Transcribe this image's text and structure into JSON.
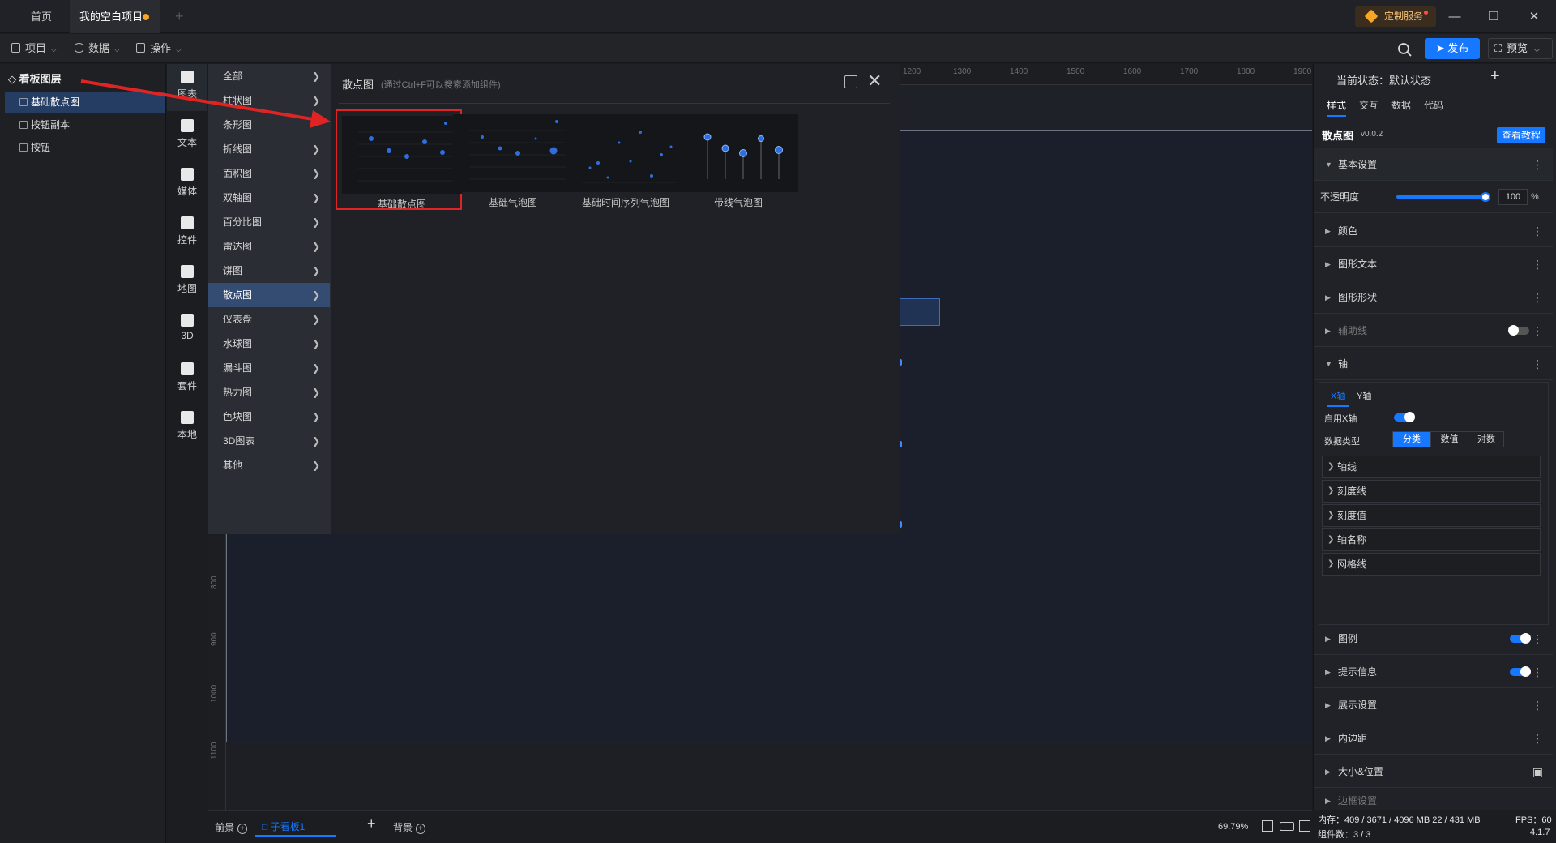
{
  "tabs": {
    "home": "首页",
    "project": "我的空白项目"
  },
  "custom_service": "定制服务",
  "menus": [
    {
      "label": "项目"
    },
    {
      "label": "数据"
    },
    {
      "label": "操作"
    }
  ],
  "toolbar": {
    "publish": "发布",
    "preview": "预览"
  },
  "layers": {
    "title": "看板图层",
    "items": [
      {
        "label": "基础散点图",
        "selected": true
      },
      {
        "label": "按钮副本",
        "selected": false
      },
      {
        "label": "按钮",
        "selected": false
      }
    ]
  },
  "categories": [
    {
      "label": "图表",
      "icon": "bar-chart-icon"
    },
    {
      "label": "文本",
      "icon": "text-icon"
    },
    {
      "label": "媒体",
      "icon": "media-icon"
    },
    {
      "label": "控件",
      "icon": "control-icon"
    },
    {
      "label": "地图",
      "icon": "map-icon"
    },
    {
      "label": "3D",
      "icon": "cube-icon"
    },
    {
      "label": "套件",
      "icon": "kit-icon"
    },
    {
      "label": "本地",
      "icon": "puzzle-icon"
    }
  ],
  "chart_types": [
    "全部",
    "柱状图",
    "条形图",
    "折线图",
    "面积图",
    "双轴图",
    "百分比图",
    "雷达图",
    "饼图",
    "散点图",
    "仪表盘",
    "水球图",
    "漏斗图",
    "热力图",
    "色块图",
    "3D图表",
    "其他"
  ],
  "chart_types_selected": "散点图",
  "picker": {
    "title": "散点图",
    "hint": "(通过Ctrl+F可以搜索添加组件)",
    "items": [
      {
        "label": "基础散点图",
        "selected": true
      },
      {
        "label": "基础气泡图",
        "selected": false
      },
      {
        "label": "基础时间序列气泡图",
        "selected": false
      },
      {
        "label": "带线气泡图",
        "selected": false
      }
    ]
  },
  "ruler": {
    "top": [
      "1200",
      "1300",
      "1400",
      "1500",
      "1600",
      "1700",
      "1800",
      "1900"
    ],
    "left": [
      "800",
      "900",
      "1000",
      "1100"
    ]
  },
  "right_panel": {
    "state_label": "当前状态：",
    "state_value": "默认状态",
    "tabs": [
      "样式",
      "交互",
      "数据",
      "代码"
    ],
    "component_name": "散点图",
    "component_version": "v0.0.2",
    "tutorial": "查看教程",
    "basic_settings": "基本设置",
    "opacity_label": "不透明度",
    "opacity_value": "100",
    "opacity_unit": "%",
    "sections_top": [
      "颜色",
      "图形文本",
      "图形形状",
      "辅助线"
    ],
    "axis": "轴",
    "axis_tabs": [
      "X轴",
      "Y轴"
    ],
    "enable_x": "启用X轴",
    "data_type_label": "数据类型",
    "data_types": [
      "分类",
      "数值",
      "对数"
    ],
    "axis_subs": [
      "轴线",
      "刻度线",
      "刻度值",
      "轴名称",
      "网格线"
    ],
    "sections_bottom": [
      "图例",
      "提示信息",
      "展示设置",
      "内边距",
      "大小&位置",
      "边框设置"
    ]
  },
  "bottom": {
    "foreground": "前景",
    "sub_board": "子看板1",
    "background": "背景",
    "zoom": "69.79%"
  },
  "status": {
    "memory": "内存：409 / 3671 / 4096 MB  22 / 431 MB",
    "fps": "FPS：60",
    "components": "组件数：3 / 3",
    "version": "4.1.7"
  }
}
